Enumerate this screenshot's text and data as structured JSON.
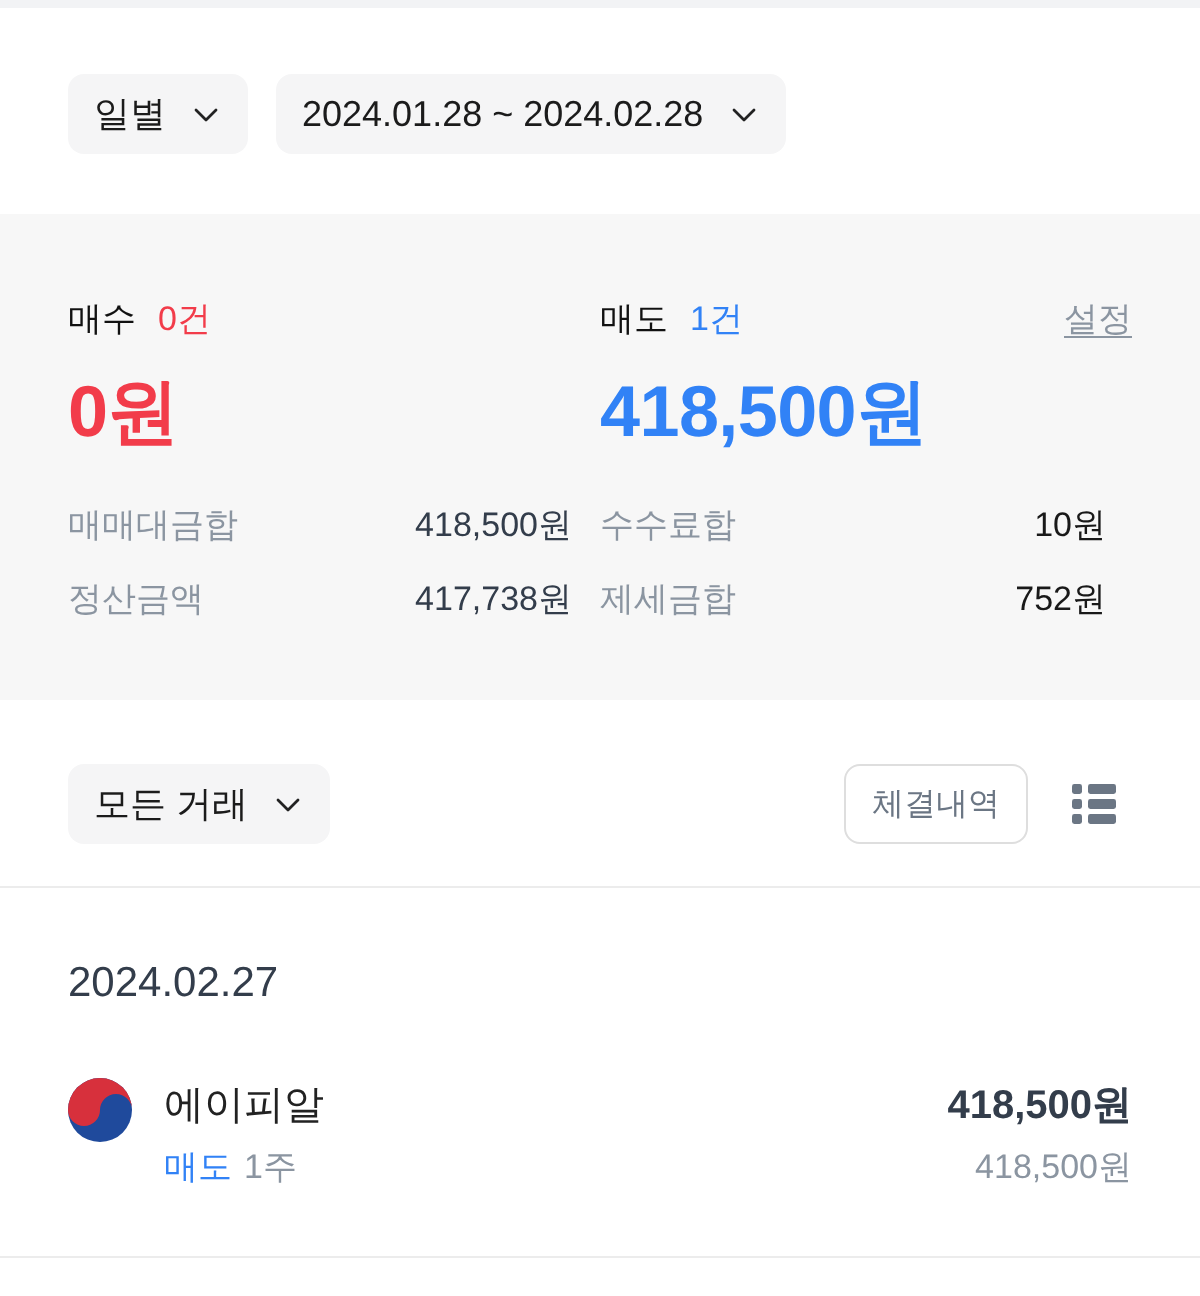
{
  "filters": [
    {
      "label": "일별"
    },
    {
      "label": "2024.01.28 ~ 2024.02.28"
    }
  ],
  "summary": {
    "sides": [
      {
        "kind": "buy",
        "label": "매수",
        "count": "0건",
        "amount": "0원"
      },
      {
        "kind": "sell",
        "label": "매도",
        "count": "1건",
        "amount": "418,500원"
      }
    ],
    "settings_link": "설정",
    "totals": [
      {
        "label": "매매대금합",
        "value": "418,500원"
      },
      {
        "label": "수수료합",
        "value": "10원"
      },
      {
        "label": "정산금액",
        "value": "417,738원"
      },
      {
        "label": "제세금합",
        "value": "752원"
      }
    ]
  },
  "toolbar": {
    "filter": "모든 거래",
    "history_button": "체결내역"
  },
  "days": [
    {
      "date": "2024.02.27",
      "trades": [
        {
          "kind": "sell",
          "name": "에이피알",
          "side": "매도",
          "quantity": "1주",
          "amount": "418,500원",
          "price": "418,500원"
        }
      ]
    }
  ]
}
